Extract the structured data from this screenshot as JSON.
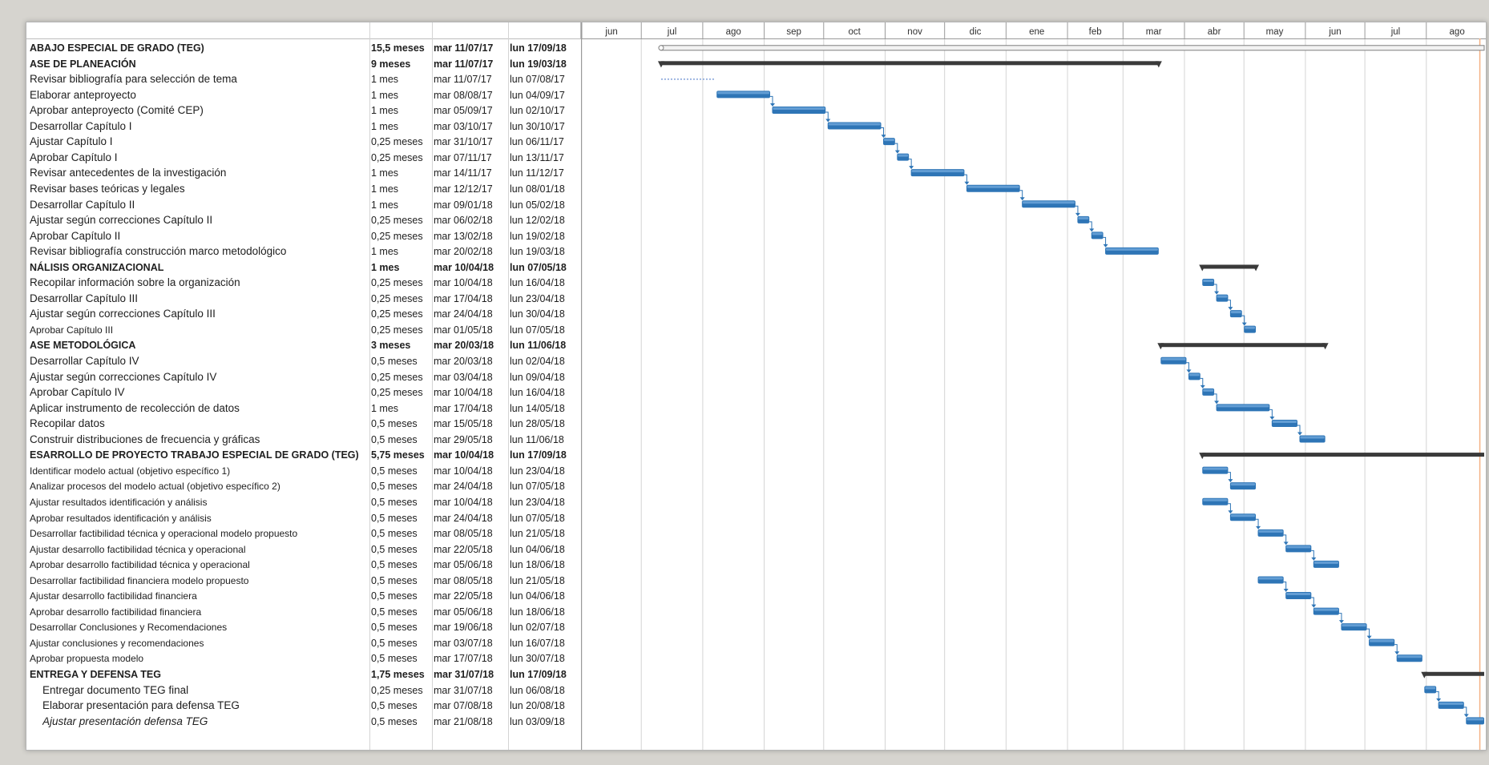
{
  "colors": {
    "task_bar": "#2e75b6",
    "task_bar_top": "#6fa8dc",
    "summary_bar": "#3a3a3a",
    "link": "#2e75b6",
    "today_line": "#f4b183",
    "grid": "#d4d4d4"
  },
  "timeline": {
    "months": [
      "jun",
      "jul",
      "ago",
      "sep",
      "oct",
      "nov",
      "dic",
      "ene",
      "feb",
      "mar",
      "abr",
      "may",
      "jun",
      "jul",
      "ago"
    ],
    "start": "2017-06-01",
    "end": "2018-08-31"
  },
  "chart_data": {
    "type": "gantt",
    "xlabel": "",
    "ylabel": "",
    "status_line": "2018-08-28",
    "tasks": [
      {
        "name": "TRABAJO ESPECIAL DE GRADO (TEG)",
        "label": "ABAJO ESPECIAL DE GRADO (TEG)",
        "duration": "15,5 meses",
        "start": "mar 11/07/17",
        "end": "lun 17/09/18",
        "summary": true,
        "bar": "project",
        "x0": "2017-07-11",
        "x1": "2018-09-17"
      },
      {
        "name": "FASE DE PLANEACIÓN",
        "label": "ASE DE PLANEACIÓN",
        "duration": "9 meses",
        "start": "mar 11/07/17",
        "end": "lun 19/03/18",
        "summary": true,
        "bar": "summary",
        "x0": "2017-07-11",
        "x1": "2018-03-19"
      },
      {
        "name": "Revisar bibliografía para selección de tema",
        "label": "Revisar bibliografía para selección de tema",
        "duration": "1 mes",
        "start": "mar 11/07/17",
        "end": "lun 07/08/17",
        "bar": "dotted",
        "x0": "2017-07-11",
        "x1": "2017-08-07"
      },
      {
        "name": "Elaborar anteproyecto",
        "label": "Elaborar anteproyecto",
        "duration": "1 mes",
        "start": "mar 08/08/17",
        "end": "lun 04/09/17",
        "bar": "task",
        "x0": "2017-08-08",
        "x1": "2017-09-04"
      },
      {
        "name": "Aprobar anteproyecto (Comité CEP)",
        "label": "Aprobar anteproyecto (Comité CEP)",
        "duration": "1 mes",
        "start": "mar 05/09/17",
        "end": "lun 02/10/17",
        "bar": "task",
        "x0": "2017-09-05",
        "x1": "2017-10-02"
      },
      {
        "name": "Desarrollar Capítulo I",
        "label": "Desarrollar Capítulo I",
        "duration": "1 mes",
        "start": "mar 03/10/17",
        "end": "lun 30/10/17",
        "bar": "task",
        "x0": "2017-10-03",
        "x1": "2017-10-30"
      },
      {
        "name": "Ajustar Capítulo I",
        "label": "Ajustar Capítulo I",
        "duration": "0,25 meses",
        "start": "mar 31/10/17",
        "end": "lun 06/11/17",
        "bar": "task",
        "x0": "2017-10-31",
        "x1": "2017-11-06"
      },
      {
        "name": "Aprobar Capítulo I",
        "label": "Aprobar Capítulo I",
        "duration": "0,25 meses",
        "start": "mar 07/11/17",
        "end": "lun 13/11/17",
        "bar": "task",
        "x0": "2017-11-07",
        "x1": "2017-11-13"
      },
      {
        "name": "Revisar antecedentes de la investigación",
        "label": "Revisar antecedentes de la investigación",
        "duration": "1 mes",
        "start": "mar 14/11/17",
        "end": "lun 11/12/17",
        "bar": "task",
        "x0": "2017-11-14",
        "x1": "2017-12-11"
      },
      {
        "name": "Revisar bases teóricas y legales",
        "label": "Revisar bases teóricas y legales",
        "duration": "1 mes",
        "start": "mar 12/12/17",
        "end": "lun 08/01/18",
        "bar": "task",
        "x0": "2017-12-12",
        "x1": "2018-01-08"
      },
      {
        "name": "Desarrollar Capítulo II",
        "label": "Desarrollar Capítulo II",
        "duration": "1 mes",
        "start": "mar 09/01/18",
        "end": "lun 05/02/18",
        "bar": "task",
        "x0": "2018-01-09",
        "x1": "2018-02-05"
      },
      {
        "name": "Ajustar según correcciones Capítulo II",
        "label": "Ajustar según correcciones Capítulo II",
        "duration": "0,25 meses",
        "start": "mar 06/02/18",
        "end": "lun 12/02/18",
        "bar": "task",
        "x0": "2018-02-06",
        "x1": "2018-02-12"
      },
      {
        "name": "Aprobar Capítulo II",
        "label": "Aprobar Capítulo II",
        "duration": "0,25 meses",
        "start": "mar 13/02/18",
        "end": "lun 19/02/18",
        "bar": "task",
        "x0": "2018-02-13",
        "x1": "2018-02-19"
      },
      {
        "name": "Revisar bibliografía construcción marco metodológico",
        "label": "Revisar bibliografía construcción marco metodológico",
        "duration": "1 mes",
        "start": "mar 20/02/18",
        "end": "lun 19/03/18",
        "bar": "task",
        "x0": "2018-02-20",
        "x1": "2018-03-19"
      },
      {
        "name": "ANÁLISIS ORGANIZACIONAL",
        "label": "NÁLISIS ORGANIZACIONAL",
        "duration": "1 mes",
        "start": "mar 10/04/18",
        "end": "lun 07/05/18",
        "summary": true,
        "bar": "summary",
        "x0": "2018-04-10",
        "x1": "2018-05-07"
      },
      {
        "name": "Recopilar información sobre la organización",
        "label": "Recopilar información sobre la organización",
        "duration": "0,25 meses",
        "start": "mar 10/04/18",
        "end": "lun 16/04/18",
        "bar": "task",
        "x0": "2018-04-10",
        "x1": "2018-04-16"
      },
      {
        "name": "Desarrollar Capítulo III",
        "label": "Desarrollar Capítulo III",
        "duration": "0,25 meses",
        "start": "mar 17/04/18",
        "end": "lun 23/04/18",
        "bar": "task",
        "x0": "2018-04-17",
        "x1": "2018-04-23"
      },
      {
        "name": "Ajustar según correcciones Capítulo III",
        "label": "Ajustar según correcciones Capítulo III",
        "duration": "0,25 meses",
        "start": "mar 24/04/18",
        "end": "lun 30/04/18",
        "bar": "task",
        "x0": "2018-04-24",
        "x1": "2018-04-30"
      },
      {
        "name": "Aprobar Capítulo III",
        "label": "Aprobar Capítulo III",
        "duration": "0,25 meses",
        "start": "mar 01/05/18",
        "end": "lun 07/05/18",
        "bar": "task",
        "x0": "2018-05-01",
        "x1": "2018-05-07",
        "small": true
      },
      {
        "name": "FASE METODOLÓGICA",
        "label": "ASE METODOLÓGICA",
        "duration": "3 meses",
        "start": "mar 20/03/18",
        "end": "lun 11/06/18",
        "summary": true,
        "bar": "summary",
        "x0": "2018-03-20",
        "x1": "2018-06-11"
      },
      {
        "name": "Desarrollar Capítulo IV",
        "label": "Desarrollar Capítulo IV",
        "duration": "0,5 meses",
        "start": "mar 20/03/18",
        "end": "lun 02/04/18",
        "bar": "task",
        "x0": "2018-03-20",
        "x1": "2018-04-02"
      },
      {
        "name": "Ajustar según correcciones Capítulo IV",
        "label": "Ajustar según correcciones Capítulo IV",
        "duration": "0,25 meses",
        "start": "mar 03/04/18",
        "end": "lun 09/04/18",
        "bar": "task",
        "x0": "2018-04-03",
        "x1": "2018-04-09"
      },
      {
        "name": "Aprobar Capítulo IV",
        "label": "Aprobar Capítulo IV",
        "duration": "0,25 meses",
        "start": "mar 10/04/18",
        "end": "lun 16/04/18",
        "bar": "task",
        "x0": "2018-04-10",
        "x1": "2018-04-16"
      },
      {
        "name": "Aplicar instrumento de recolección de datos",
        "label": "Aplicar instrumento de recolección de datos",
        "duration": "1 mes",
        "start": "mar 17/04/18",
        "end": "lun 14/05/18",
        "bar": "task",
        "x0": "2018-04-17",
        "x1": "2018-05-14"
      },
      {
        "name": "Recopilar datos",
        "label": "Recopilar datos",
        "duration": "0,5 meses",
        "start": "mar 15/05/18",
        "end": "lun 28/05/18",
        "bar": "task",
        "x0": "2018-05-15",
        "x1": "2018-05-28"
      },
      {
        "name": "Construir distribuciones de frecuencia y gráficas",
        "label": "Construir distribuciones de frecuencia y gráficas",
        "duration": "0,5 meses",
        "start": "mar 29/05/18",
        "end": "lun 11/06/18",
        "bar": "task",
        "x0": "2018-05-29",
        "x1": "2018-06-11"
      },
      {
        "name": "DESARROLLO DE PROYECTO TRABAJO ESPECIAL DE GRADO (TEG)",
        "label": "ESARROLLO DE PROYECTO TRABAJO ESPECIAL DE GRADO (TEG)",
        "duration": "5,75 meses",
        "start": "mar 10/04/18",
        "end": "lun 17/09/18",
        "summary": true,
        "bar": "summary",
        "x0": "2018-04-10",
        "x1": "2018-09-17"
      },
      {
        "name": "Identificar modelo actual (objetivo específico 1)",
        "label": "Identificar modelo actual (objetivo específico 1)",
        "duration": "0,5 meses",
        "start": "mar 10/04/18",
        "end": "lun 23/04/18",
        "bar": "task",
        "x0": "2018-04-10",
        "x1": "2018-04-23",
        "small": true
      },
      {
        "name": "Analizar procesos del modelo actual (objetivo específico 2)",
        "label": "Analizar procesos del modelo actual (objetivo específico 2)",
        "duration": "0,5 meses",
        "start": "mar 24/04/18",
        "end": "lun 07/05/18",
        "bar": "task",
        "x0": "2018-04-24",
        "x1": "2018-05-07",
        "small": true
      },
      {
        "name": "Ajustar resultados identificación y análisis",
        "label": "Ajustar resultados identificación y análisis",
        "duration": "0,5 meses",
        "start": "mar 10/04/18",
        "end": "lun 23/04/18",
        "bar": "task",
        "x0": "2018-04-10",
        "x1": "2018-04-23",
        "small": true
      },
      {
        "name": "Aprobar resultados identificación y análisis",
        "label": "Aprobar resultados identificación y análisis",
        "duration": "0,5 meses",
        "start": "mar 24/04/18",
        "end": "lun 07/05/18",
        "bar": "task",
        "x0": "2018-04-24",
        "x1": "2018-05-07",
        "small": true
      },
      {
        "name": "Desarrollar factibilidad técnica y operacional modelo propuesto",
        "label": "Desarrollar factibilidad técnica y operacional modelo propuesto",
        "duration": "0,5 meses",
        "start": "mar 08/05/18",
        "end": "lun 21/05/18",
        "bar": "task",
        "x0": "2018-05-08",
        "x1": "2018-05-21",
        "small": true
      },
      {
        "name": "Ajustar desarrollo factibilidad técnica y operacional",
        "label": "Ajustar desarrollo factibilidad técnica y operacional",
        "duration": "0,5 meses",
        "start": "mar 22/05/18",
        "end": "lun 04/06/18",
        "bar": "task",
        "x0": "2018-05-22",
        "x1": "2018-06-04",
        "small": true
      },
      {
        "name": "Aprobar desarrollo factibilidad técnica y operacional",
        "label": "Aprobar desarrollo factibilidad técnica y operacional",
        "duration": "0,5 meses",
        "start": "mar 05/06/18",
        "end": "lun 18/06/18",
        "bar": "task",
        "x0": "2018-06-05",
        "x1": "2018-06-18",
        "small": true
      },
      {
        "name": "Desarrollar factibilidad financiera modelo propuesto",
        "label": "Desarrollar factibilidad financiera modelo propuesto",
        "duration": "0,5 meses",
        "start": "mar 08/05/18",
        "end": "lun 21/05/18",
        "bar": "task",
        "x0": "2018-05-08",
        "x1": "2018-05-21",
        "small": true
      },
      {
        "name": "Ajustar desarrollo factibilidad financiera",
        "label": "Ajustar desarrollo factibilidad financiera",
        "duration": "0,5 meses",
        "start": "mar 22/05/18",
        "end": "lun 04/06/18",
        "bar": "task",
        "x0": "2018-05-22",
        "x1": "2018-06-04",
        "small": true
      },
      {
        "name": "Aprobar desarrollo factibilidad financiera",
        "label": "Aprobar desarrollo factibilidad financiera",
        "duration": "0,5 meses",
        "start": "mar 05/06/18",
        "end": "lun 18/06/18",
        "bar": "task",
        "x0": "2018-06-05",
        "x1": "2018-06-18",
        "small": true
      },
      {
        "name": "Desarrollar Conclusiones y Recomendaciones",
        "label": "Desarrollar Conclusiones y Recomendaciones",
        "duration": "0,5 meses",
        "start": "mar 19/06/18",
        "end": "lun 02/07/18",
        "bar": "task",
        "x0": "2018-06-19",
        "x1": "2018-07-02",
        "small": true
      },
      {
        "name": "Ajustar conclusiones y recomendaciones",
        "label": "Ajustar conclusiones y recomendaciones",
        "duration": "0,5 meses",
        "start": "mar 03/07/18",
        "end": "lun 16/07/18",
        "bar": "task",
        "x0": "2018-07-03",
        "x1": "2018-07-16",
        "small": true
      },
      {
        "name": "Aprobar propuesta modelo",
        "label": "Aprobar propuesta modelo",
        "duration": "0,5 meses",
        "start": "mar 17/07/18",
        "end": "lun 30/07/18",
        "bar": "task",
        "x0": "2018-07-17",
        "x1": "2018-07-30",
        "small": true
      },
      {
        "name": "ENTREGA Y DEFENSA TEG",
        "label": "ENTREGA Y DEFENSA TEG",
        "duration": "1,75 meses",
        "start": "mar 31/07/18",
        "end": "lun 17/09/18",
        "summary": true,
        "bar": "summary",
        "x0": "2018-07-31",
        "x1": "2018-09-17"
      },
      {
        "name": "Entregar documento TEG final",
        "label": "Entregar documento TEG final",
        "duration": "0,25 meses",
        "start": "mar 31/07/18",
        "end": "lun 06/08/18",
        "bar": "task",
        "x0": "2018-07-31",
        "x1": "2018-08-06",
        "indent": true
      },
      {
        "name": "Elaborar presentación para defensa TEG",
        "label": "Elaborar presentación para defensa TEG",
        "duration": "0,5 meses",
        "start": "mar 07/08/18",
        "end": "lun 20/08/18",
        "bar": "task",
        "x0": "2018-08-07",
        "x1": "2018-08-20",
        "indent": true
      },
      {
        "name": "Ajustar presentación defensa TEG",
        "label": "Ajustar presentación defensa TEG",
        "duration": "0,5 meses",
        "start": "mar 21/08/18",
        "end": "lun 03/09/18",
        "bar": "task",
        "x0": "2018-08-21",
        "x1": "2018-09-03",
        "indent": true,
        "italic": true
      }
    ]
  }
}
